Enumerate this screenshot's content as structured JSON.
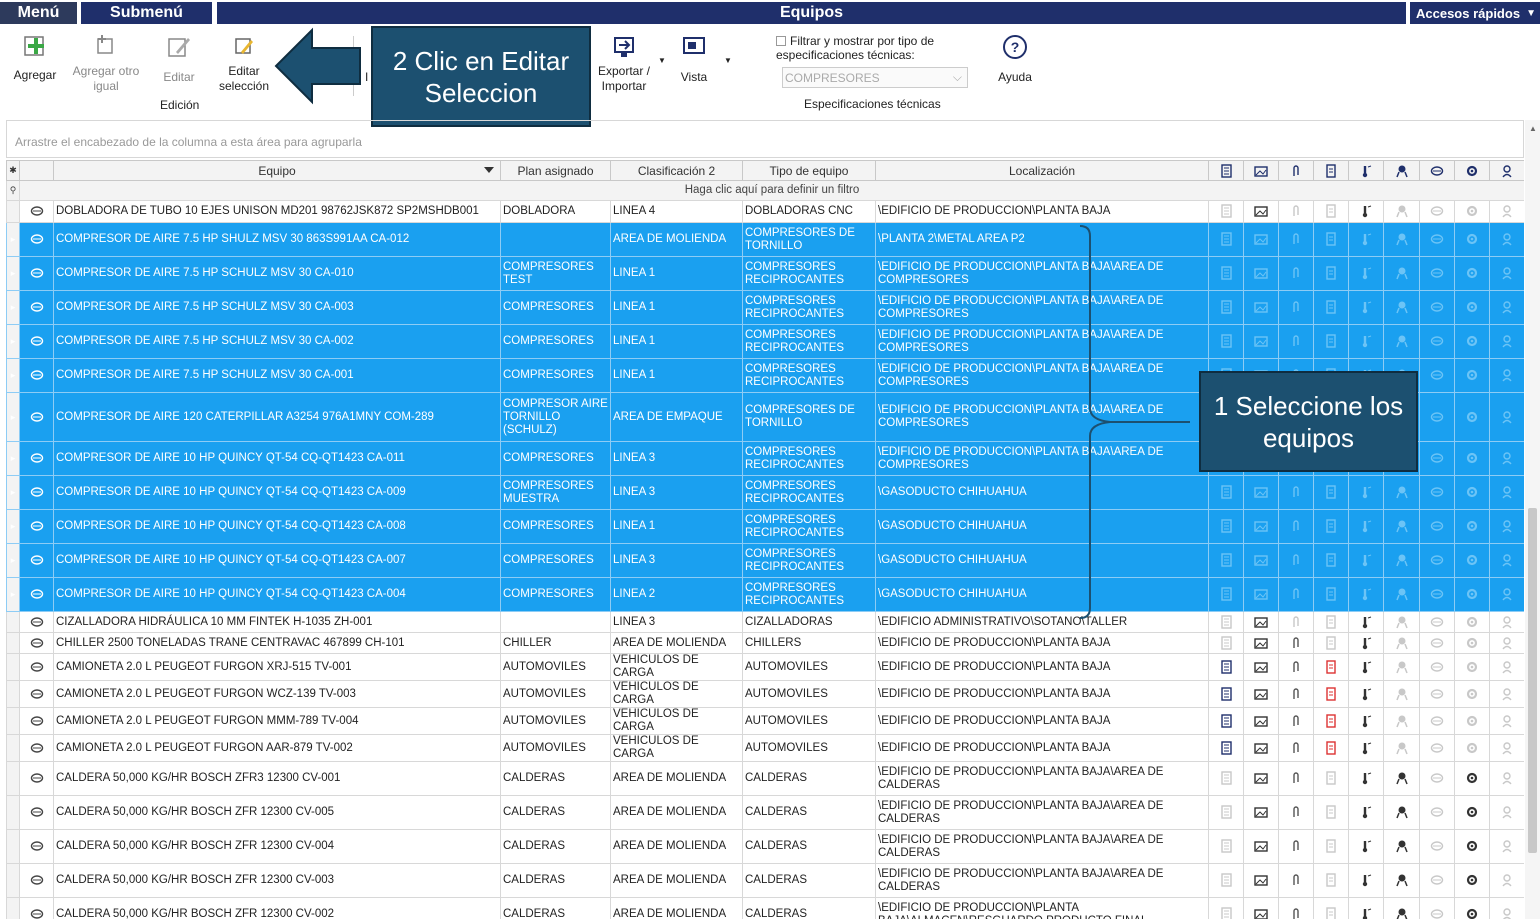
{
  "topbar": {
    "menu": "Menú",
    "submenu": "Submenú",
    "title": "Equipos",
    "quick_access": "Accesos rápidos"
  },
  "ribbon": {
    "add": "Agregar",
    "add_same": "Agregar otro igual",
    "edit": "Editar",
    "edit_selection": "Editar selección",
    "edition_group": "Edición",
    "partial_label": "I",
    "export_import": "Exportar / Importar",
    "view": "Vista",
    "filter_label": "Filtrar y mostrar por tipo de especificaciones técnicas:",
    "filter_value": "COMPRESORES",
    "specs_group": "Especificaciones técnicas",
    "help": "Ayuda"
  },
  "callouts": {
    "step2": "2 Clic en Editar Seleccion",
    "step1": "1 Seleccione los equipos"
  },
  "grid": {
    "group_hint": "Arrastre el encabezado de la columna a esta área para agruparla",
    "filter_hint": "Haga clic aquí para definir un filtro",
    "columns": {
      "equipo": "Equipo",
      "plan": "Plan asignado",
      "clasif": "Clasificación 2",
      "tipo": "Tipo de equipo",
      "loc": "Localización"
    },
    "rows": [
      {
        "equipo": "DOBLADORA DE TUBO 10 EJES UNISON MD201 98762JSK872 SP2MSHDB001",
        "plan": "DOBLADORA",
        "clasif": "LINEA 4",
        "tipo": "DOBLADORAS CNC",
        "loc": "\\EDIFICIO DE PRODUCCION\\PLANTA BAJA",
        "sel": false
      },
      {
        "equipo": "COMPRESOR DE AIRE 7.5 HP SHULZ MSV 30 863S991AA CA-012",
        "plan": "",
        "clasif": "AREA DE MOLIENDA",
        "tipo": "COMPRESORES DE TORNILLO",
        "loc": "\\PLANTA 2\\METAL AREA P2",
        "sel": true
      },
      {
        "equipo": "COMPRESOR DE AIRE 7.5 HP SCHULZ MSV 30 CA-010",
        "plan": "COMPRESORES TEST",
        "clasif": "LINEA 1",
        "tipo": "COMPRESORES RECIPROCANTES",
        "loc": "\\EDIFICIO DE PRODUCCION\\PLANTA BAJA\\AREA DE COMPRESORES",
        "sel": true
      },
      {
        "equipo": "COMPRESOR DE AIRE 7.5 HP SCHULZ MSV 30 CA-003",
        "plan": "COMPRESORES",
        "clasif": "LINEA 1",
        "tipo": "COMPRESORES RECIPROCANTES",
        "loc": "\\EDIFICIO DE PRODUCCION\\PLANTA BAJA\\AREA DE COMPRESORES",
        "sel": true
      },
      {
        "equipo": "COMPRESOR DE AIRE 7.5 HP SCHULZ MSV 30 CA-002",
        "plan": "COMPRESORES",
        "clasif": "LINEA 1",
        "tipo": "COMPRESORES RECIPROCANTES",
        "loc": "\\EDIFICIO DE PRODUCCION\\PLANTA BAJA\\AREA DE COMPRESORES",
        "sel": true
      },
      {
        "equipo": "COMPRESOR DE AIRE 7.5 HP SCHULZ MSV 30 CA-001",
        "plan": "COMPRESORES",
        "clasif": "LINEA 1",
        "tipo": "COMPRESORES RECIPROCANTES",
        "loc": "\\EDIFICIO DE PRODUCCION\\PLANTA BAJA\\AREA DE COMPRESORES",
        "sel": true
      },
      {
        "equipo": "COMPRESOR DE AIRE 120 CATERPILLAR A3254 976A1MNY COM-289",
        "plan": "COMPRESOR AIRE TORNILLO (SCHULZ)",
        "clasif": "AREA DE EMPAQUE",
        "tipo": "COMPRESORES DE TORNILLO",
        "loc": "\\EDIFICIO DE PRODUCCION\\PLANTA BAJA\\AREA DE COMPRESORES",
        "sel": true
      },
      {
        "equipo": "COMPRESOR DE AIRE 10 HP QUINCY QT-54 CQ-QT1423 CA-011",
        "plan": "COMPRESORES",
        "clasif": "LINEA 3",
        "tipo": "COMPRESORES RECIPROCANTES",
        "loc": "\\EDIFICIO DE PRODUCCION\\PLANTA BAJA\\AREA DE COMPRESORES",
        "sel": true
      },
      {
        "equipo": "COMPRESOR DE AIRE 10 HP QUINCY QT-54 CQ-QT1423 CA-009",
        "plan": "COMPRESORES MUESTRA",
        "clasif": "LINEA 3",
        "tipo": "COMPRESORES RECIPROCANTES",
        "loc": "\\GASODUCTO CHIHUAHUA",
        "sel": true
      },
      {
        "equipo": "COMPRESOR DE AIRE 10 HP QUINCY QT-54 CQ-QT1423 CA-008",
        "plan": "COMPRESORES",
        "clasif": "LINEA 1",
        "tipo": "COMPRESORES RECIPROCANTES",
        "loc": "\\GASODUCTO CHIHUAHUA",
        "sel": true
      },
      {
        "equipo": "COMPRESOR DE AIRE 10 HP QUINCY QT-54 CQ-QT1423 CA-007",
        "plan": "COMPRESORES",
        "clasif": "LINEA 3",
        "tipo": "COMPRESORES RECIPROCANTES",
        "loc": "\\GASODUCTO CHIHUAHUA",
        "sel": true
      },
      {
        "equipo": "COMPRESOR DE AIRE 10 HP QUINCY QT-54 CQ-QT1423 CA-004",
        "plan": "COMPRESORES",
        "clasif": "LINEA 2",
        "tipo": "COMPRESORES RECIPROCANTES",
        "loc": "\\GASODUCTO CHIHUAHUA",
        "sel": true
      },
      {
        "equipo": "CIZALLADORA HIDRÁULICA 10 MM FINTEK H-1035 ZH-001",
        "plan": "",
        "clasif": "LINEA 3",
        "tipo": "CIZALLADORAS",
        "loc": "\\EDIFICIO ADMINISTRATIVO\\SOTANO\\TALLER",
        "sel": false
      },
      {
        "equipo": "CHILLER 2500 TONELADAS TRANE CENTRAVAC 467899 CH-101",
        "plan": "CHILLER",
        "clasif": "AREA DE MOLIENDA",
        "tipo": "CHILLERS",
        "loc": "\\EDIFICIO DE PRODUCCION\\PLANTA BAJA",
        "sel": false
      },
      {
        "equipo": "CAMIONETA 2.0 L PEUGEOT FURGON XRJ-515 TV-001",
        "plan": "AUTOMOVILES",
        "clasif": "VEHICULOS DE CARGA",
        "tipo": "AUTOMOVILES",
        "loc": "\\EDIFICIO DE PRODUCCION\\PLANTA BAJA",
        "sel": false
      },
      {
        "equipo": "CAMIONETA 2.0 L PEUGEOT FURGON WCZ-139 TV-003",
        "plan": "AUTOMOVILES",
        "clasif": "VEHICULOS DE CARGA",
        "tipo": "AUTOMOVILES",
        "loc": "\\EDIFICIO DE PRODUCCION\\PLANTA BAJA",
        "sel": false
      },
      {
        "equipo": "CAMIONETA 2.0 L PEUGEOT FURGON MMM-789 TV-004",
        "plan": "AUTOMOVILES",
        "clasif": "VEHICULOS DE CARGA",
        "tipo": "AUTOMOVILES",
        "loc": "\\EDIFICIO DE PRODUCCION\\PLANTA BAJA",
        "sel": false
      },
      {
        "equipo": "CAMIONETA 2.0 L PEUGEOT FURGON AAR-879 TV-002",
        "plan": "AUTOMOVILES",
        "clasif": "VEHICULOS DE CARGA",
        "tipo": "AUTOMOVILES",
        "loc": "\\EDIFICIO DE PRODUCCION\\PLANTA BAJA",
        "sel": false
      },
      {
        "equipo": "CALDERA 50,000 KG/HR BOSCH ZFR3 12300 CV-001",
        "plan": "CALDERAS",
        "clasif": "AREA DE MOLIENDA",
        "tipo": "CALDERAS",
        "loc": "\\EDIFICIO DE PRODUCCION\\PLANTA BAJA\\AREA DE CALDERAS",
        "sel": false
      },
      {
        "equipo": "CALDERA 50,000 KG/HR BOSCH ZFR 12300 CV-005",
        "plan": "CALDERAS",
        "clasif": "AREA DE MOLIENDA",
        "tipo": "CALDERAS",
        "loc": "\\EDIFICIO DE PRODUCCION\\PLANTA BAJA\\AREA DE CALDERAS",
        "sel": false
      },
      {
        "equipo": "CALDERA 50,000 KG/HR BOSCH ZFR 12300 CV-004",
        "plan": "CALDERAS",
        "clasif": "AREA DE MOLIENDA",
        "tipo": "CALDERAS",
        "loc": "\\EDIFICIO DE PRODUCCION\\PLANTA BAJA\\AREA DE CALDERAS",
        "sel": false
      },
      {
        "equipo": "CALDERA 50,000 KG/HR BOSCH ZFR 12300 CV-003",
        "plan": "CALDERAS",
        "clasif": "AREA DE MOLIENDA",
        "tipo": "CALDERAS",
        "loc": "\\EDIFICIO DE PRODUCCION\\PLANTA BAJA\\AREA DE CALDERAS",
        "sel": false
      },
      {
        "equipo": "CALDERA 50,000 KG/HR BOSCH ZFR 12300 CV-002",
        "plan": "CALDERAS",
        "clasif": "AREA DE MOLIENDA",
        "tipo": "CALDERAS",
        "loc": "\\EDIFICIO DE PRODUCCION\\PLANTA BAJA\\ALMACEN\\RESGUARDO PRODUCTO FINAL",
        "sel": false
      }
    ]
  },
  "colors": {
    "header_navy": "#1f2f6b",
    "selection_blue": "#1aa0f0",
    "callout": "#1c5070",
    "accent_green": "#3aa845"
  }
}
